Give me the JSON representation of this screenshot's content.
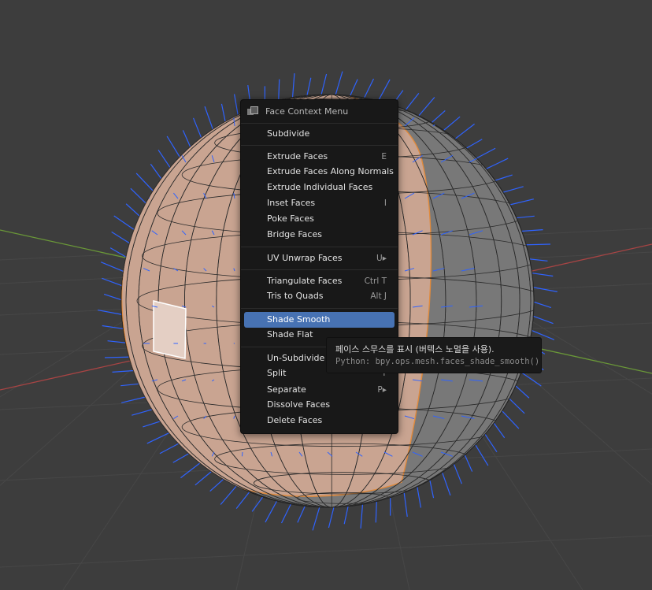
{
  "colors": {
    "background": "#3d3d3d",
    "menu_background": "#181818",
    "highlight": "#4772b3",
    "selected_faces": "#d9a98c",
    "normals": "#2f63ff",
    "x_axis": "#b04040",
    "y_axis": "#6a9a3a"
  },
  "menu": {
    "title": "Face Context Menu",
    "title_icon": "face-select-mode-icon",
    "items": [
      {
        "label": "Subdivide",
        "shortcut": ""
      },
      {
        "label": "Extrude Faces",
        "shortcut": "E"
      },
      {
        "label": "Extrude Faces Along Normals",
        "shortcut": ""
      },
      {
        "label": "Extrude Individual Faces",
        "shortcut": ""
      },
      {
        "label": "Inset Faces",
        "shortcut": "I"
      },
      {
        "label": "Poke Faces",
        "shortcut": ""
      },
      {
        "label": "Bridge Faces",
        "shortcut": ""
      },
      {
        "label": "UV Unwrap Faces",
        "shortcut": "U▸"
      },
      {
        "label": "Triangulate Faces",
        "shortcut": "Ctrl T"
      },
      {
        "label": "Tris to Quads",
        "shortcut": "Alt J"
      },
      {
        "label": "Shade Smooth",
        "shortcut": ""
      },
      {
        "label": "Shade Flat",
        "shortcut": ""
      },
      {
        "label": "Un-Subdivide",
        "shortcut": ""
      },
      {
        "label": "Split",
        "shortcut": "Y"
      },
      {
        "label": "Separate",
        "shortcut": "P▸"
      },
      {
        "label": "Dissolve Faces",
        "shortcut": ""
      },
      {
        "label": "Delete Faces",
        "shortcut": ""
      }
    ],
    "highlighted": "Shade Smooth"
  },
  "tooltip": {
    "description": "페이스 스무스를 표시 (버텍스 노멀을 사용).",
    "python": "Python: bpy.ops.mesh.faces_shade_smooth()"
  }
}
